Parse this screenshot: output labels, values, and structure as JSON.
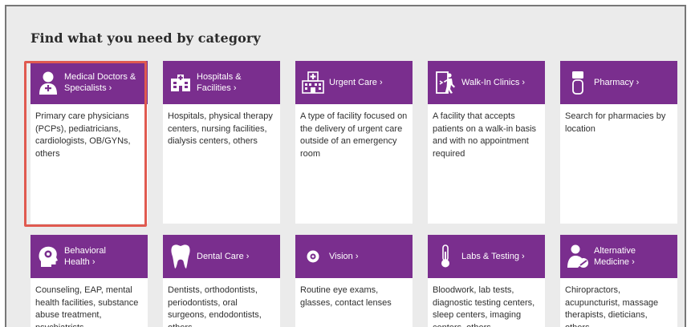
{
  "page": {
    "heading": "Find what you need by category"
  },
  "cards": [
    {
      "title_line1": "Medical Doctors &",
      "title_line2": "Specialists",
      "chevron": "›",
      "icon": "doctor-icon",
      "description": "Primary care physicians (PCPs), pediatricians, cardiologists, OB/GYNs, others"
    },
    {
      "title_line1": "Hospitals &",
      "title_line2": "Facilities",
      "chevron": "›",
      "icon": "hospital-building-icon",
      "description": "Hospitals, physical therapy centers, nursing facilities, dialysis centers, others"
    },
    {
      "title_line1": "Urgent Care",
      "title_line2": "",
      "chevron": "›",
      "icon": "urgent-care-building-icon",
      "description": "A type of facility focused on the delivery of urgent care outside of an emergency room"
    },
    {
      "title_line1": "Walk-In Clinics",
      "title_line2": "",
      "chevron": "›",
      "icon": "walk-in-door-icon",
      "description": "A facility that accepts patients on a walk-in basis and with no appointment required"
    },
    {
      "title_line1": "Pharmacy",
      "title_line2": "",
      "chevron": "›",
      "icon": "pill-bottle-icon",
      "description": "Search for pharmacies by location"
    },
    {
      "title_line1": "Behavioral",
      "title_line2": "Health",
      "chevron": "›",
      "icon": "head-profile-icon",
      "description": "Counseling, EAP, mental health facilities, substance abuse treatment, psychiatrists"
    },
    {
      "title_line1": "Dental Care",
      "title_line2": "",
      "chevron": "›",
      "icon": "tooth-icon",
      "description": "Dentists, orthodontists, periodontists, oral surgeons, endodontists, others"
    },
    {
      "title_line1": "Vision",
      "title_line2": "",
      "chevron": "›",
      "icon": "eye-icon",
      "description": "Routine eye exams, glasses, contact lenses"
    },
    {
      "title_line1": "Labs & Testing",
      "title_line2": "",
      "chevron": "›",
      "icon": "thermometer-icon",
      "description": "Bloodwork, lab tests, diagnostic testing centers, sleep centers, imaging centers, others"
    },
    {
      "title_line1": "Alternative",
      "title_line2": "Medicine",
      "chevron": "›",
      "icon": "alternative-medicine-icon",
      "description": "Chiropractors, acupuncturist, massage therapists, dieticians, others"
    }
  ],
  "colors": {
    "card_header": "#7a2e8e",
    "highlight_border": "#e05a50",
    "background": "#ebebeb"
  }
}
